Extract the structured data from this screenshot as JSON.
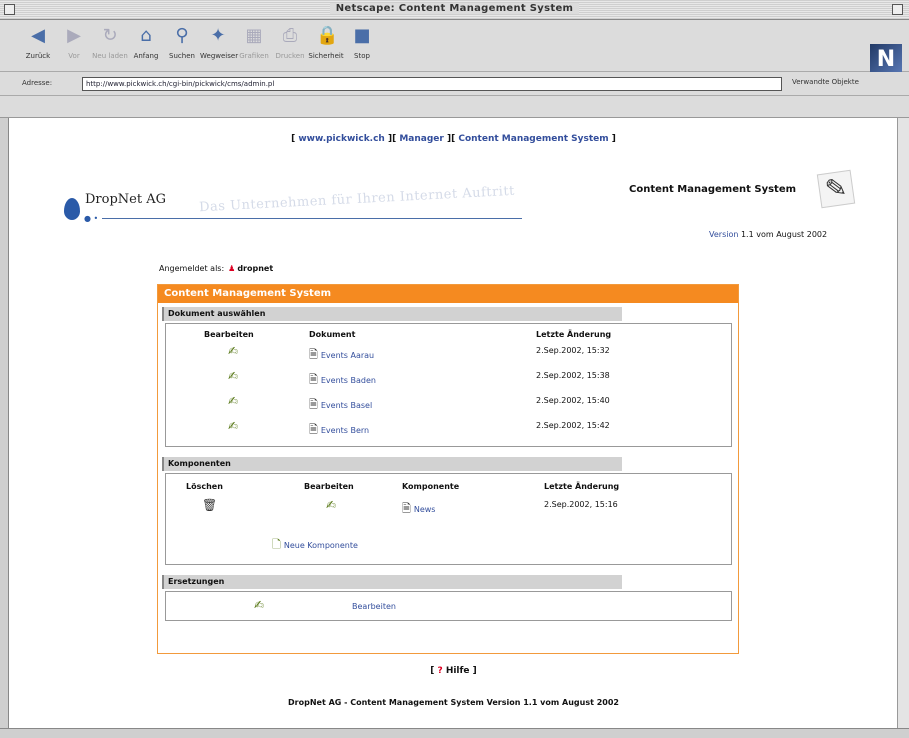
{
  "window": {
    "title": "Netscape: Content Management System"
  },
  "toolbar": {
    "buttons": [
      {
        "label": "Zurück",
        "icon": "back-icon",
        "enabled": true
      },
      {
        "label": "Vor",
        "icon": "forward-icon",
        "enabled": false
      },
      {
        "label": "Neu laden",
        "icon": "reload-icon",
        "enabled": false
      },
      {
        "label": "Anfang",
        "icon": "home-icon",
        "enabled": true
      },
      {
        "label": "Suchen",
        "icon": "search-icon",
        "enabled": true
      },
      {
        "label": "Wegweiser",
        "icon": "guide-icon",
        "enabled": true
      },
      {
        "label": "Grafiken",
        "icon": "images-icon",
        "enabled": false
      },
      {
        "label": "Drucken",
        "icon": "print-icon",
        "enabled": false
      },
      {
        "label": "Sicherheit",
        "icon": "security-icon",
        "enabled": true
      },
      {
        "label": "Stop",
        "icon": "stop-icon",
        "enabled": true
      }
    ]
  },
  "address": {
    "label": "Adresse:",
    "url": "http://www.pickwick.ch/cgi-bin/pickwick/cms/admin.pl",
    "related": "Verwandte Objekte"
  },
  "page": {
    "topnav": {
      "link1": "www.pickwick.ch",
      "link2": "Manager",
      "link3": "Content Management System"
    },
    "logo": {
      "name": "DropNet AG",
      "slogan": "Das Unternehmen für Ihren Internet Auftritt"
    },
    "cms_title": "Content Management System",
    "version_link": "Version",
    "version_text": "1.1 vom August 2002",
    "login": {
      "label": "Angemeldet als:",
      "user": "dropnet"
    },
    "panel_title": "Content Management System",
    "documents": {
      "heading": "Dokument auswählen",
      "col_edit": "Bearbeiten",
      "col_doc": "Dokument",
      "col_changed": "Letzte Änderung",
      "rows": [
        {
          "name": "Events Aarau",
          "changed": "2.Sep.2002, 15:32"
        },
        {
          "name": "Events Baden",
          "changed": "2.Sep.2002, 15:38"
        },
        {
          "name": "Events Basel",
          "changed": "2.Sep.2002, 15:40"
        },
        {
          "name": "Events Bern",
          "changed": "2.Sep.2002, 15:42"
        }
      ]
    },
    "components": {
      "heading": "Komponenten",
      "col_delete": "Löschen",
      "col_edit": "Bearbeiten",
      "col_comp": "Komponente",
      "col_changed": "Letzte Änderung",
      "rows": [
        {
          "name": "News",
          "changed": "2.Sep.2002, 15:16"
        }
      ],
      "new_label": "Neue Komponente"
    },
    "replacements": {
      "heading": "Ersetzungen",
      "edit_label": "Bearbeiten"
    },
    "help": {
      "mark": "?",
      "label": "Hilfe"
    },
    "footer": "DropNet AG - Content Management System Version 1.1 vom August 2002"
  }
}
